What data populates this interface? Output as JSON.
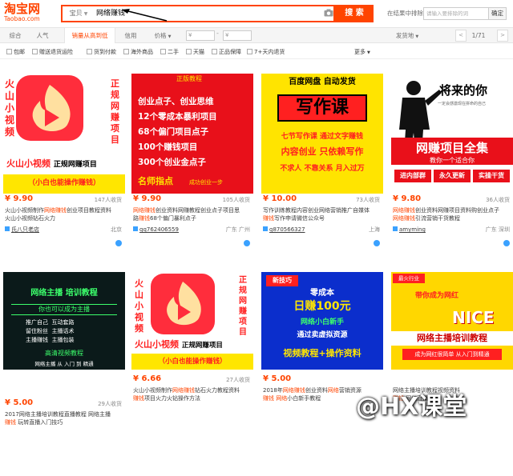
{
  "header": {
    "logo_cn": "淘宝网",
    "logo_en": "Taobao.com",
    "search_category": "宝贝",
    "search_query": "网络赚钱",
    "search_button": "搜 索",
    "result_search_label": "在结果中排除",
    "result_search_placeholder": "请输入要排除的词",
    "result_search_button": "确定"
  },
  "sortbar": {
    "items": [
      "综合",
      "人气",
      "销量从高到低",
      "信用",
      "价格"
    ],
    "price_min": "¥",
    "price_max": "¥",
    "ship_from": "发货地",
    "page": "1/71"
  },
  "filters": [
    "包邮",
    "赠送退货运险",
    "货到付款",
    "海外商品",
    "二手",
    "天猫",
    "正品保障",
    "7+天内退货"
  ],
  "filters_more": "更多",
  "cards": [
    {
      "price": "¥ 9.90",
      "sold": "147人收货",
      "title1": "火山小视频制作网络赚钱创业项目教程资料",
      "title2": "火山小视频钻石火力",
      "shop": "氏八只老店",
      "loc": "北京",
      "img": {
        "head": "",
        "l1": "火山小视频",
        "l2": "正规网赚项目",
        "l3": "（小白也能操作赚钱）"
      }
    },
    {
      "price": "¥ 9.90",
      "sold": "105人收货",
      "title1": "网络赚钱创业资料网赚教程创业点子项目思",
      "title2": "路赚钱68个偏门暴利点子",
      "shop": "qq762406559",
      "loc": "广东 广州",
      "img": {
        "head": "正版教程",
        "l1": "创业点子、创业思维",
        "l2": "12个零成本暴利项目",
        "l3": "68个偏门项目点子",
        "l4": "100个赚钱项目",
        "l5": "300个创业金点子",
        "l6": "名师指点",
        "l7": "成功创业一步"
      }
    },
    {
      "price": "¥ 10.00",
      "sold": "73人收货",
      "title1": "写作训练教程内容创业网络营销推广自媒体",
      "title2": "赚钱写作申请微信公众号",
      "shop": "q870566327",
      "loc": "上海",
      "img": {
        "head": "百度网盘 自动发货",
        "l1": "写作课",
        "l2": "七节写作课 通过文字赚钱",
        "l3": "内容创业 只依赖写作",
        "l4": "不求人 不靠关系 月入过万"
      }
    },
    {
      "price": "¥ 9.80",
      "sold": "36人收货",
      "title1": "网络赚钱创业资料网赚项目资料购创业点子",
      "title2": "网络赚钱引流营销干货教程",
      "shop": "amyming",
      "loc": "广东 深圳",
      "img": {
        "l1": "将来的你",
        "l2": "一定会感激现在拼命的自己",
        "l3": "网赚项目全集",
        "l4": "教你一个适合你",
        "l5": "进内部群",
        "l6": "永久更新",
        "l7": "实操干货"
      }
    },
    {
      "price": "¥ 5.00",
      "sold": "29人收货",
      "title1": "2017网络主播培训教程直播教程 网络主播",
      "title2": "赚钱 玩转直播入门技巧",
      "shop": "",
      "loc": "",
      "img": {
        "l1": "网络主播 培训教程",
        "l2": "你也可以成为主播",
        "l3": "推广自己",
        "l4": "互动套路",
        "l5": "留住粉丝",
        "l6": "主播话术",
        "l7": "主播赚钱",
        "l8": "主播包装",
        "l9": "高清视频教程",
        "l10": "网络主播 从 入门 到 精通"
      }
    },
    {
      "price": "¥ 6.66",
      "sold": "27人收货",
      "title1": "火山小视频制作网络赚钱钻石火力教程资料",
      "title2": "赚钱项目火力火钻操作方法",
      "shop": "",
      "loc": "",
      "img": {
        "l1": "火山小视频",
        "l2": "正规网赚项目",
        "l3": "（小白也能操作赚钱）"
      }
    },
    {
      "price": "¥ 5.00",
      "sold": "",
      "title1": "2018年网络赚钱创业资料网络营销资源",
      "title2": "赚钱 网络小白新手教程",
      "shop": "",
      "loc": "",
      "img": {
        "head": "新技巧",
        "l1": "零成本",
        "l2": "日赚100元",
        "l3": "网络小白新手",
        "l4": "通过卖虚拟资源",
        "l5": "视频教程+操作资料"
      }
    },
    {
      "price": "",
      "sold": "",
      "title1": "网络主播培训教程视频资料",
      "title2": "赚钱 网红直播入门",
      "shop": "",
      "loc": "",
      "img": {
        "head": "最火行业",
        "l1": "带你成为网红",
        "l2": "NICE",
        "l3": "网络主播培训教程",
        "l4": "成为网红很简单 从入门到精通"
      }
    }
  ],
  "watermark": "@HX课堂",
  "colors": {
    "accent": "#ff4400",
    "link": "#3aa1ff"
  }
}
